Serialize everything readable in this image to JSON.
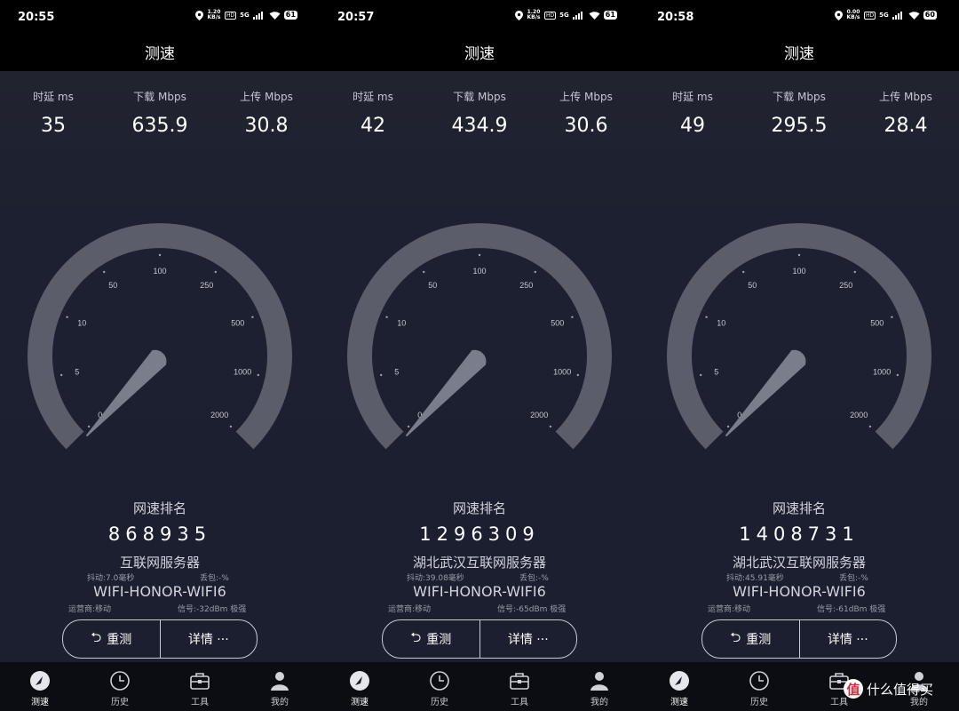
{
  "panels": [
    {
      "status": {
        "time": "20:55",
        "netspeed": "1.20 KB/s",
        "network": "5G",
        "battery": "61"
      },
      "title": "测速",
      "metrics": [
        {
          "label": "时延 ms",
          "value": "35"
        },
        {
          "label": "下载 Mbps",
          "value": "635.9"
        },
        {
          "label": "上传 Mbps",
          "value": "30.8"
        }
      ],
      "gauge": {
        "ticks": [
          "0",
          "5",
          "10",
          "50",
          "100",
          "250",
          "500",
          "1000",
          "2000"
        ]
      },
      "rank_label": "网速排名",
      "rank": "868935",
      "server": "互联网服务器",
      "jitter": "抖动:7.0毫秒",
      "loss": "丢包:-%",
      "ssid": "WIFI-HONOR-WIFI6",
      "carrier": "运营商:移动",
      "signal": "信号:-32dBm 极强",
      "buttons": {
        "retest": "重测",
        "details": "详情 ···"
      },
      "nav": [
        "测速",
        "历史",
        "工具",
        "我的"
      ]
    },
    {
      "status": {
        "time": "20:57",
        "netspeed": "1.20 KB/s",
        "network": "5G",
        "battery": "61"
      },
      "title": "测速",
      "metrics": [
        {
          "label": "时延 ms",
          "value": "42"
        },
        {
          "label": "下载 Mbps",
          "value": "434.9"
        },
        {
          "label": "上传 Mbps",
          "value": "30.6"
        }
      ],
      "gauge": {
        "ticks": [
          "0",
          "5",
          "10",
          "50",
          "100",
          "250",
          "500",
          "1000",
          "2000"
        ]
      },
      "rank_label": "网速排名",
      "rank": "1296309",
      "server": "湖北武汉互联网服务器",
      "jitter": "抖动:39.08毫秒",
      "loss": "丢包:-%",
      "ssid": "WIFI-HONOR-WIFI6",
      "carrier": "运营商:移动",
      "signal": "信号:-65dBm 极强",
      "buttons": {
        "retest": "重测",
        "details": "详情 ···"
      },
      "nav": [
        "测速",
        "历史",
        "工具",
        "我的"
      ]
    },
    {
      "status": {
        "time": "20:58",
        "netspeed": "0.00 KB/s",
        "network": "5G",
        "battery": "60"
      },
      "title": "测速",
      "metrics": [
        {
          "label": "时延 ms",
          "value": "49"
        },
        {
          "label": "下载 Mbps",
          "value": "295.5"
        },
        {
          "label": "上传 Mbps",
          "value": "28.4"
        }
      ],
      "gauge": {
        "ticks": [
          "0",
          "5",
          "10",
          "50",
          "100",
          "250",
          "500",
          "1000",
          "2000"
        ]
      },
      "rank_label": "网速排名",
      "rank": "1408731",
      "server": "湖北武汉互联网服务器",
      "jitter": "抖动:45.91毫秒",
      "loss": "丢包:-%",
      "ssid": "WIFI-HONOR-WIFI6",
      "carrier": "运营商:移动",
      "signal": "信号:-61dBm 极强",
      "buttons": {
        "retest": "重测",
        "details": "详情 ···"
      },
      "nav": [
        "测速",
        "历史",
        "工具",
        "我的"
      ]
    }
  ],
  "watermark": {
    "logo": "值",
    "text": "什么值得买"
  },
  "colors": {
    "background": "#1b1f2f",
    "gauge_arc": "#5b5d6b",
    "needle": "#7a7d8c",
    "bar": "#000000"
  }
}
